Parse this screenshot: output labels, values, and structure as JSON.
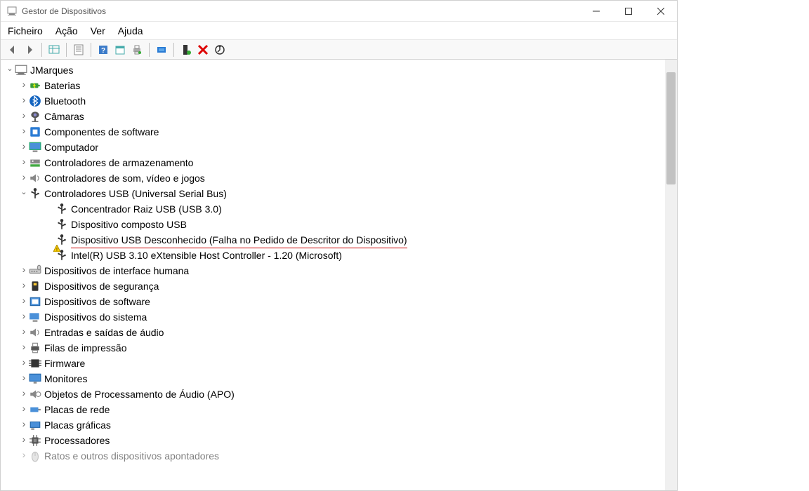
{
  "window": {
    "title": "Gestor de Dispositivos"
  },
  "menu": {
    "file": "Ficheiro",
    "action": "Ação",
    "view": "Ver",
    "help": "Ajuda"
  },
  "tree": {
    "root": "JMarques",
    "baterias": "Baterias",
    "bluetooth": "Bluetooth",
    "camaras": "Câmaras",
    "componentes_software": "Componentes de software",
    "computador": "Computador",
    "controladores_armazenamento": "Controladores de armazenamento",
    "controladores_som": "Controladores de som, vídeo e jogos",
    "controladores_usb": "Controladores USB (Universal Serial Bus)",
    "usb_root_hub": "Concentrador Raiz USB (USB 3.0)",
    "usb_composite": "Dispositivo composto USB",
    "usb_unknown": "Dispositivo USB Desconhecido (Falha no Pedido de Descritor do Dispositivo)",
    "usb_intel": "Intel(R) USB 3.10 eXtensible Host Controller - 1.20 (Microsoft)",
    "hid": "Dispositivos de interface humana",
    "seguranca": "Dispositivos de segurança",
    "software_devices": "Dispositivos de software",
    "sistema": "Dispositivos do sistema",
    "audio_io": "Entradas e saídas de áudio",
    "print_queues": "Filas de impressão",
    "firmware": "Firmware",
    "monitores": "Monitores",
    "apo": "Objetos de Processamento de Áudio (APO)",
    "placas_rede": "Placas de rede",
    "placas_graficas": "Placas gráficas",
    "processadores": "Processadores",
    "ratos": "Ratos e outros dispositivos apontadores"
  }
}
